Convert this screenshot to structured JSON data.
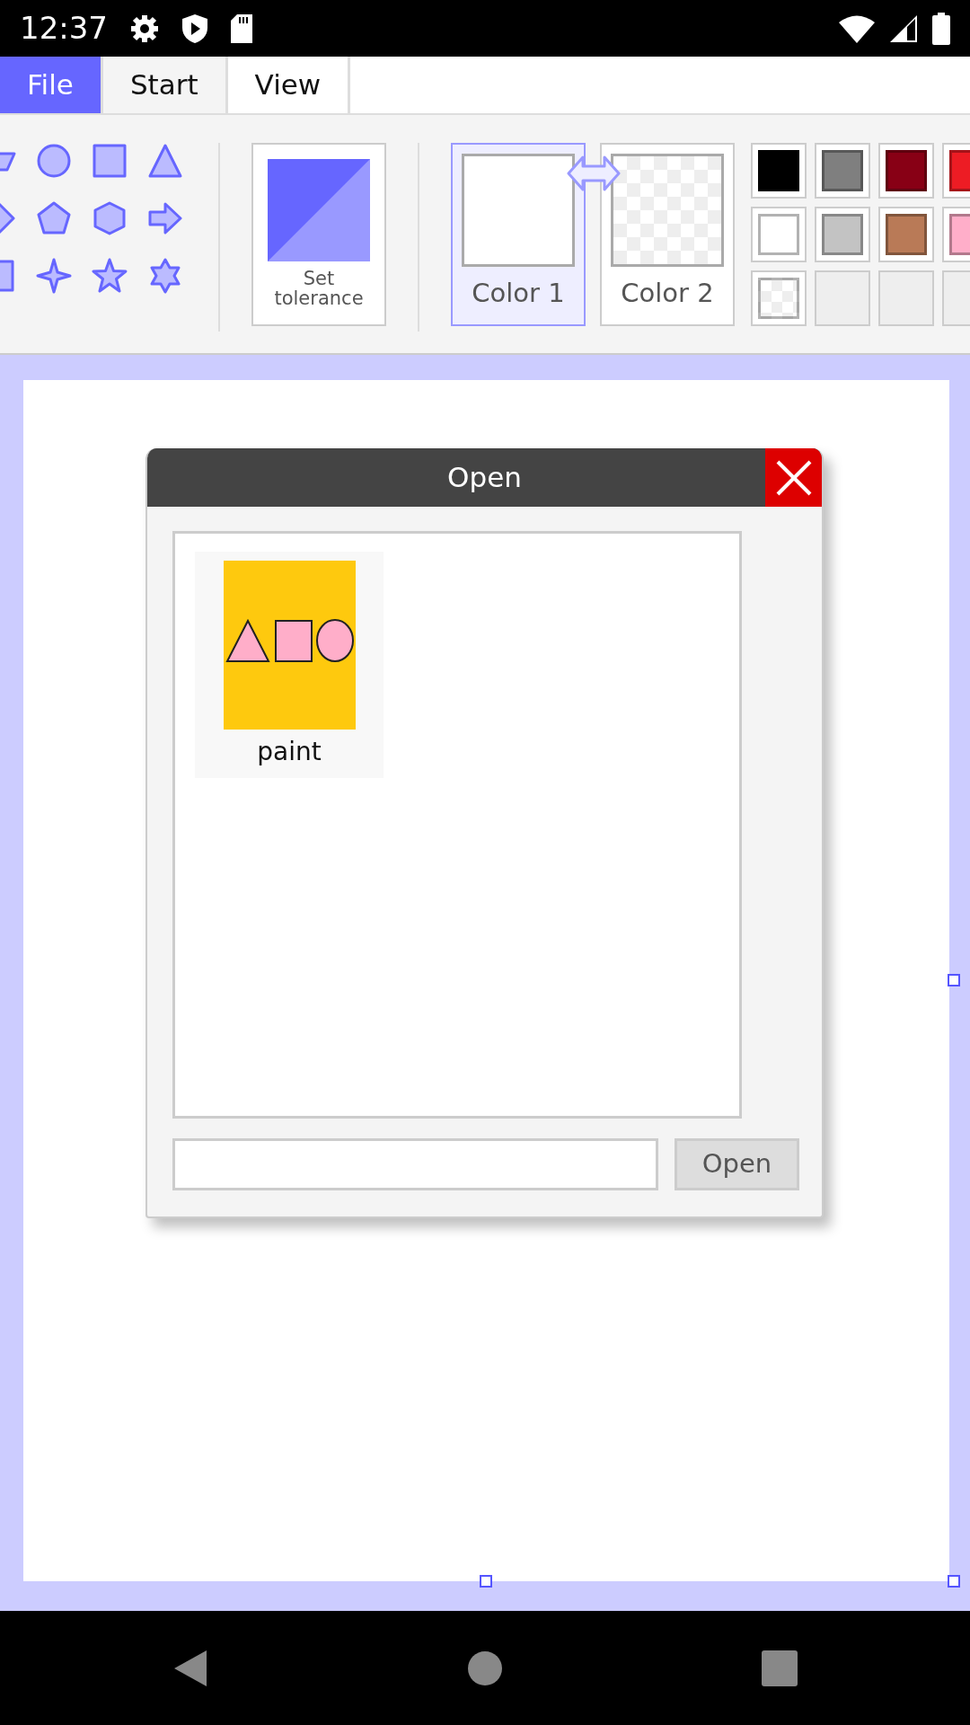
{
  "status_bar": {
    "time": "12:37"
  },
  "tabs": [
    {
      "label": "File",
      "selected": true
    },
    {
      "label": "Start",
      "selected": false
    },
    {
      "label": "View",
      "selected": false
    }
  ],
  "ribbon": {
    "tolerance_button": {
      "label": "Set tolerance"
    },
    "colors": [
      {
        "label": "Color 1",
        "selected": true,
        "kind": "solid",
        "color": "#ffffff"
      },
      {
        "label": "Color 2",
        "selected": false,
        "kind": "transparent"
      }
    ],
    "palette": [
      {
        "kind": "solid",
        "color": "#000000"
      },
      {
        "kind": "solid",
        "color": "#7f7f7f"
      },
      {
        "kind": "solid",
        "color": "#880015"
      },
      {
        "kind": "solid",
        "color": "#ed1c24"
      },
      {
        "kind": "solid",
        "color": "#ffffff"
      },
      {
        "kind": "solid",
        "color": "#c3c3c3"
      },
      {
        "kind": "solid",
        "color": "#b97a57"
      },
      {
        "kind": "solid",
        "color": "#ffaec9"
      },
      {
        "kind": "transparent"
      },
      {
        "kind": "empty"
      },
      {
        "kind": "empty"
      },
      {
        "kind": "empty"
      }
    ]
  },
  "dialog": {
    "title": "Open",
    "files": [
      {
        "name": "paint"
      }
    ],
    "open_button": "Open"
  }
}
